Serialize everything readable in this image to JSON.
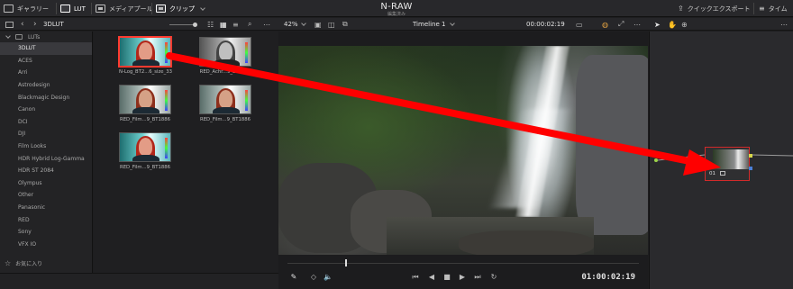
{
  "topbar": {
    "gallery_label": "ギャラリー",
    "lut_label": "LUT",
    "media_pool_label": "メディアプール",
    "clip_label": "クリップ",
    "app_title": "N-RAW",
    "app_subtitle": "編集済み",
    "quick_export_label": "クイックエクスポート",
    "timeline_label": "タイム"
  },
  "bar2": {
    "folder_label": "3DLUT",
    "zoom": "42%",
    "timeline_name": "Timeline 1",
    "timecode": "00:00:02:19"
  },
  "sidebar": {
    "root_label": "LUTs",
    "items": [
      "3DLUT",
      "ACES",
      "Arri",
      "Astrodesign",
      "Blackmagic Design",
      "Canon",
      "DCI",
      "DJI",
      "Film Looks",
      "HDR Hybrid Log-Gamma",
      "HDR ST 2084",
      "Olympus",
      "Other",
      "Panasonic",
      "RED",
      "Sony",
      "VFX IO"
    ],
    "favorites_label": "お気に入り"
  },
  "thumbnails": [
    {
      "caption": "N-Log_BT2...6_size_33",
      "style": "teal",
      "selected": true
    },
    {
      "caption": "RED_Achr...9_BT1886",
      "style": "gray",
      "selected": false
    },
    {
      "caption": "RED_Film...9_BT1886",
      "style": "normal",
      "selected": false
    },
    {
      "caption": "RED_Film...9_BT1886",
      "style": "normal",
      "selected": false
    },
    {
      "caption": "RED_Film...9_BT1886",
      "style": "teal",
      "selected": false
    }
  ],
  "viewer": {
    "transport_timecode": "01:00:02:19"
  },
  "node": {
    "label": "01"
  },
  "colors": {
    "accent": "#ff0000",
    "node_border": "#d12a2a",
    "selection": "#ff3b30"
  }
}
